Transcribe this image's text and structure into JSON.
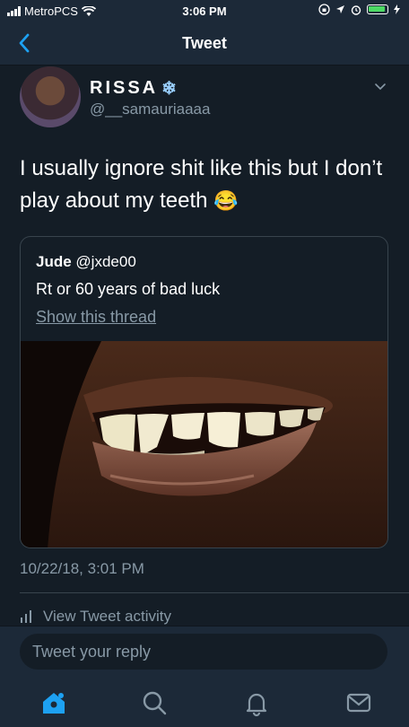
{
  "status_bar": {
    "carrier": "MetroPCS",
    "time": "3:06 PM"
  },
  "nav": {
    "title": "Tweet"
  },
  "tweet": {
    "display_name": "RISSA",
    "name_emoji": "❄",
    "handle": "@__samauriaaaa",
    "text": "I usually ignore shit like this but I don’t play about my teeth",
    "text_emoji": "😂",
    "timestamp": "10/22/18, 3:01 PM",
    "activity_label": "View Tweet activity"
  },
  "quoted_tweet": {
    "author_name": "Jude",
    "author_handle": "@jxde00",
    "text": "Rt or 60 years of bad luck",
    "thread_link": "Show this thread"
  },
  "reply": {
    "placeholder": "Tweet your reply"
  },
  "tabs": [
    "home",
    "search",
    "notifications",
    "messages"
  ],
  "colors": {
    "background": "#141d26",
    "bar": "#1c2938",
    "accent": "#1da1f2",
    "muted": "#8899a6"
  }
}
